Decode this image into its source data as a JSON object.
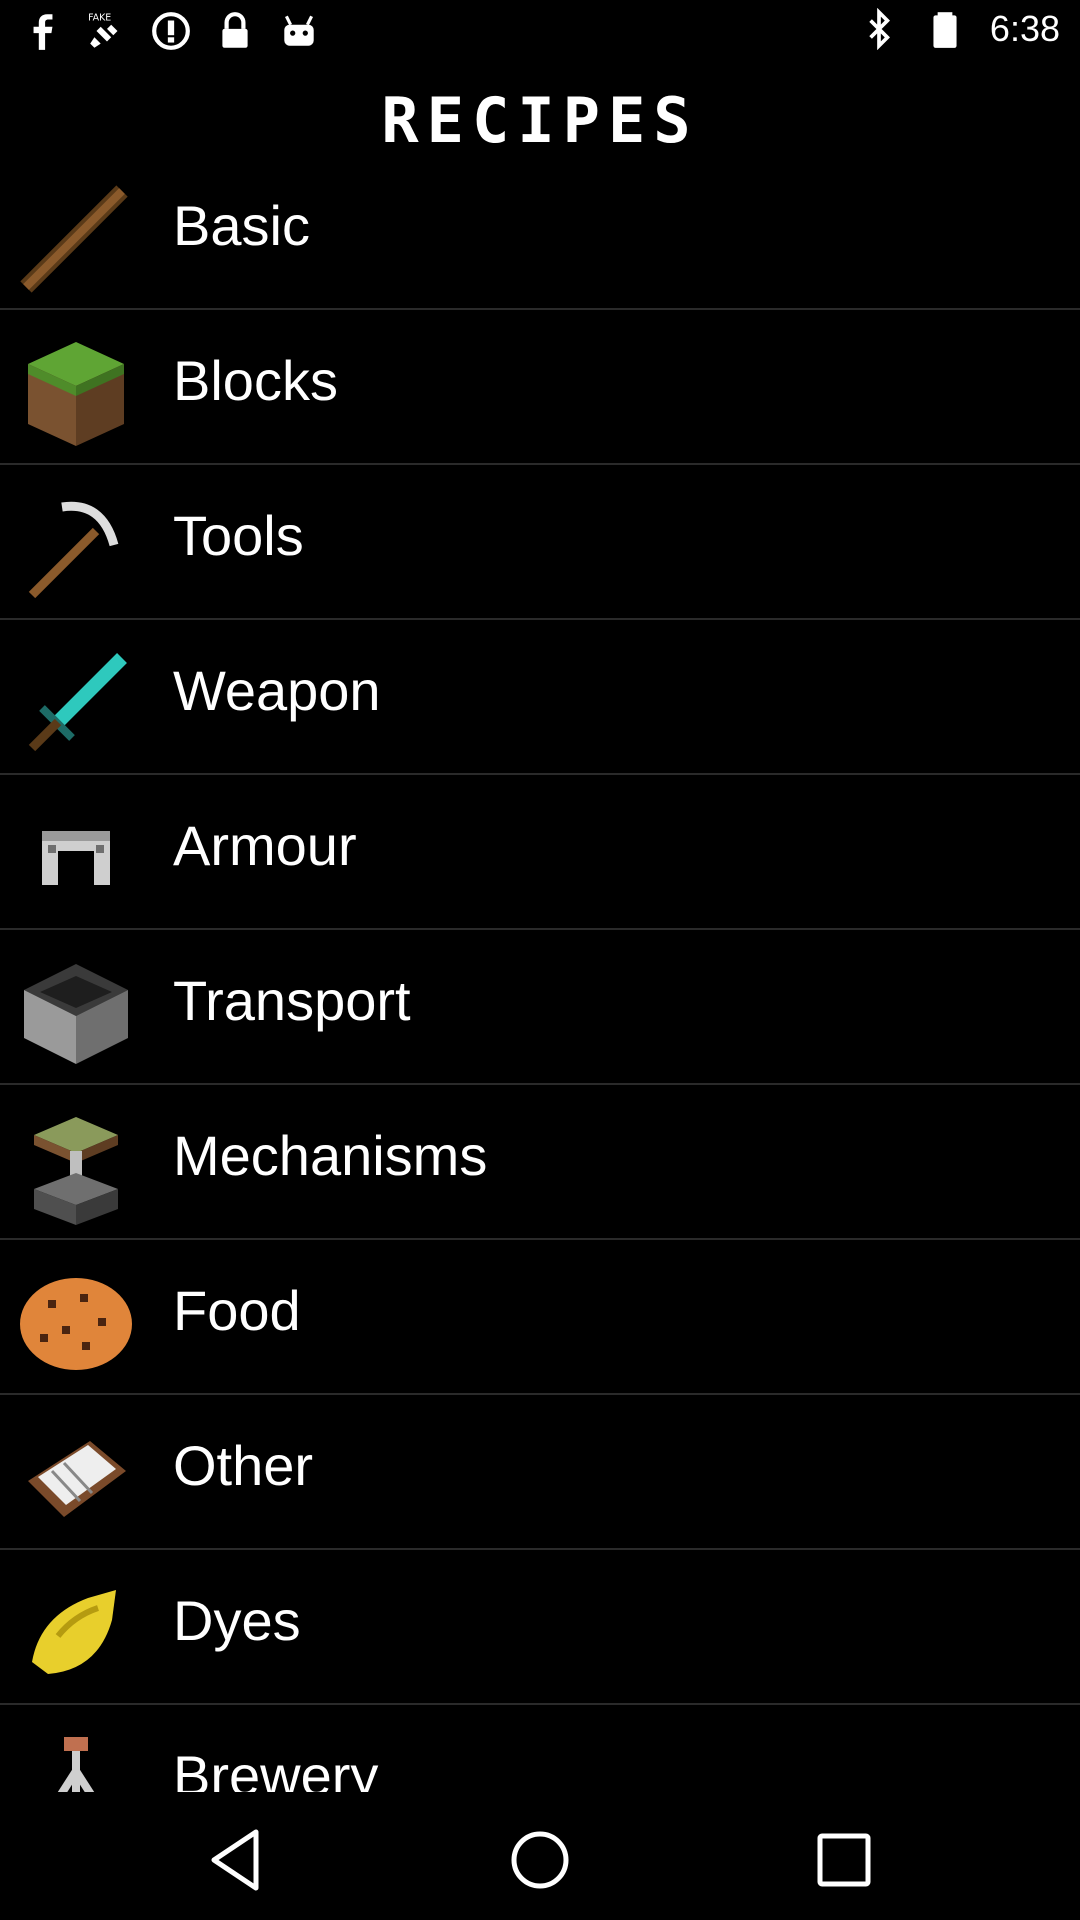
{
  "status_bar": {
    "time": "6:38",
    "left_icons": [
      "facebook-icon",
      "fake-gps-icon",
      "info-icon",
      "lock-icon",
      "android-icon"
    ],
    "right_icons": [
      "bluetooth-icon",
      "battery-icon"
    ]
  },
  "header": {
    "title": "RECIPES"
  },
  "categories": [
    {
      "label": "Basic",
      "icon": "stick-icon"
    },
    {
      "label": "Blocks",
      "icon": "grass-block-icon"
    },
    {
      "label": "Tools",
      "icon": "pickaxe-icon"
    },
    {
      "label": "Weapon",
      "icon": "diamond-sword-icon"
    },
    {
      "label": "Armour",
      "icon": "helmet-icon"
    },
    {
      "label": "Transport",
      "icon": "minecart-icon"
    },
    {
      "label": "Mechanisms",
      "icon": "piston-icon"
    },
    {
      "label": "Food",
      "icon": "cookie-icon"
    },
    {
      "label": "Other",
      "icon": "book-icon"
    },
    {
      "label": "Dyes",
      "icon": "yellow-dye-icon"
    },
    {
      "label": "Brewery",
      "icon": "brewing-stand-icon"
    }
  ],
  "nav_bar": {
    "buttons": [
      "back-icon",
      "home-icon",
      "recents-icon"
    ]
  }
}
